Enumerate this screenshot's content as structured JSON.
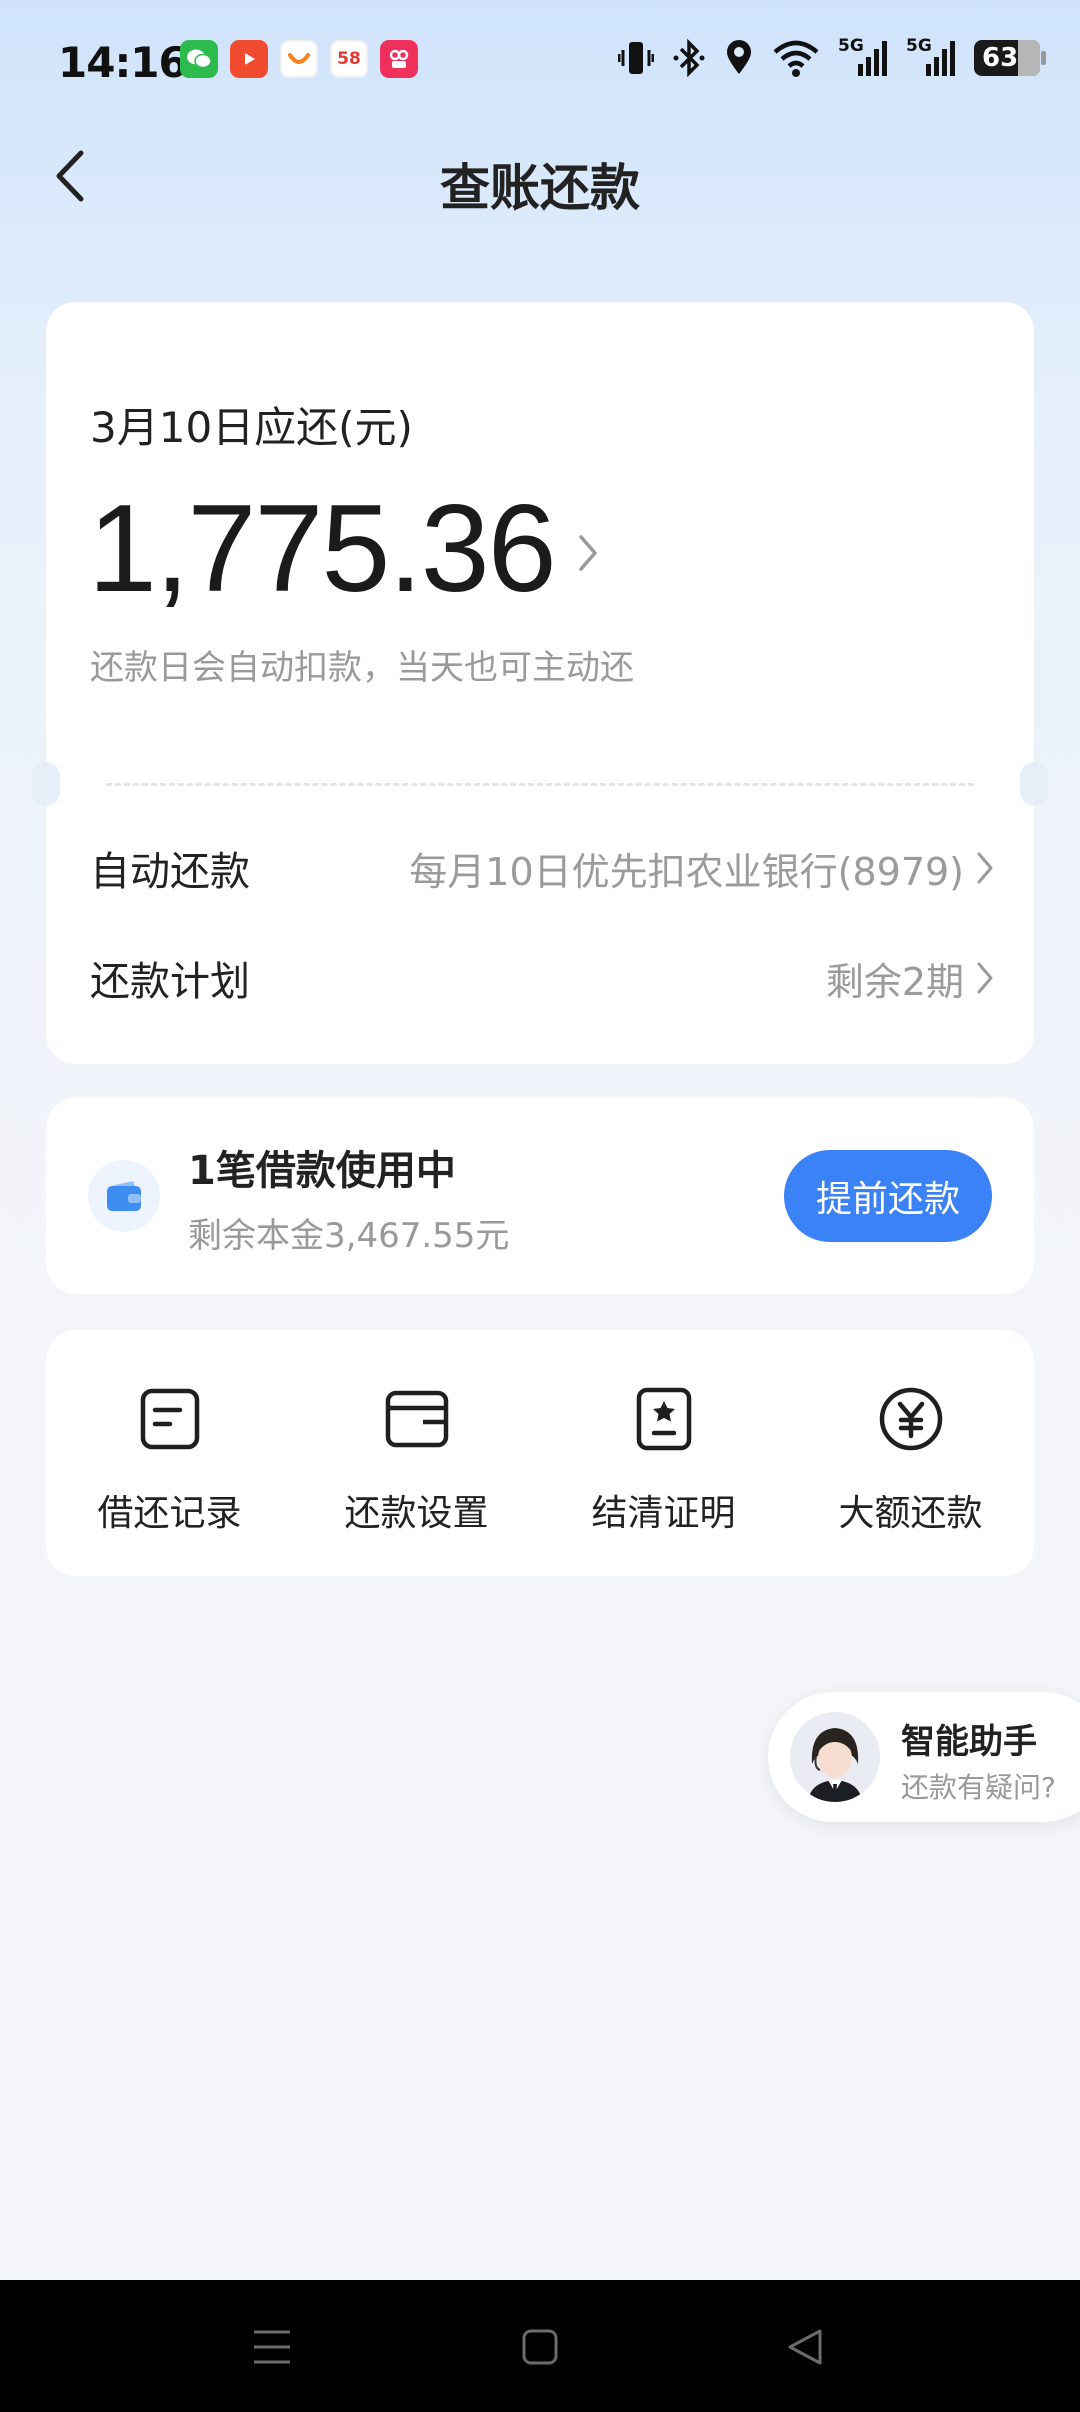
{
  "status_bar": {
    "time": "14:16",
    "app_icons": [
      "wechat-icon",
      "video-app-icon",
      "didi-icon",
      "58-app-icon",
      "qixi-app-icon"
    ],
    "app_58_label": "58",
    "signal_1": "5G",
    "signal_2": "5G",
    "battery": "63"
  },
  "header": {
    "title": "查账还款"
  },
  "bill": {
    "due_label": "3月10日应还(元)",
    "amount": "1,775.36",
    "hint": "还款日会自动扣款，当天也可主动还",
    "auto_repay_label": "自动还款",
    "auto_repay_value": "每月10日优先扣农业银行(8979)",
    "plan_label": "还款计划",
    "plan_value": "剩余2期"
  },
  "loan": {
    "title": "1笔借款使用中",
    "remaining": "剩余本金3,467.55元",
    "prepay_button": "提前还款"
  },
  "menu": {
    "items": [
      {
        "label": "借还记录",
        "icon": "record-icon"
      },
      {
        "label": "还款设置",
        "icon": "wallet-settings-icon"
      },
      {
        "label": "结清证明",
        "icon": "certificate-icon"
      },
      {
        "label": "大额还款",
        "icon": "yuan-icon"
      }
    ]
  },
  "assistant": {
    "title": "智能助手",
    "subtitle": "还款有疑问?"
  },
  "colors": {
    "accent": "#3b82f6",
    "text_primary": "#222222",
    "text_secondary": "#9a9a9a"
  }
}
